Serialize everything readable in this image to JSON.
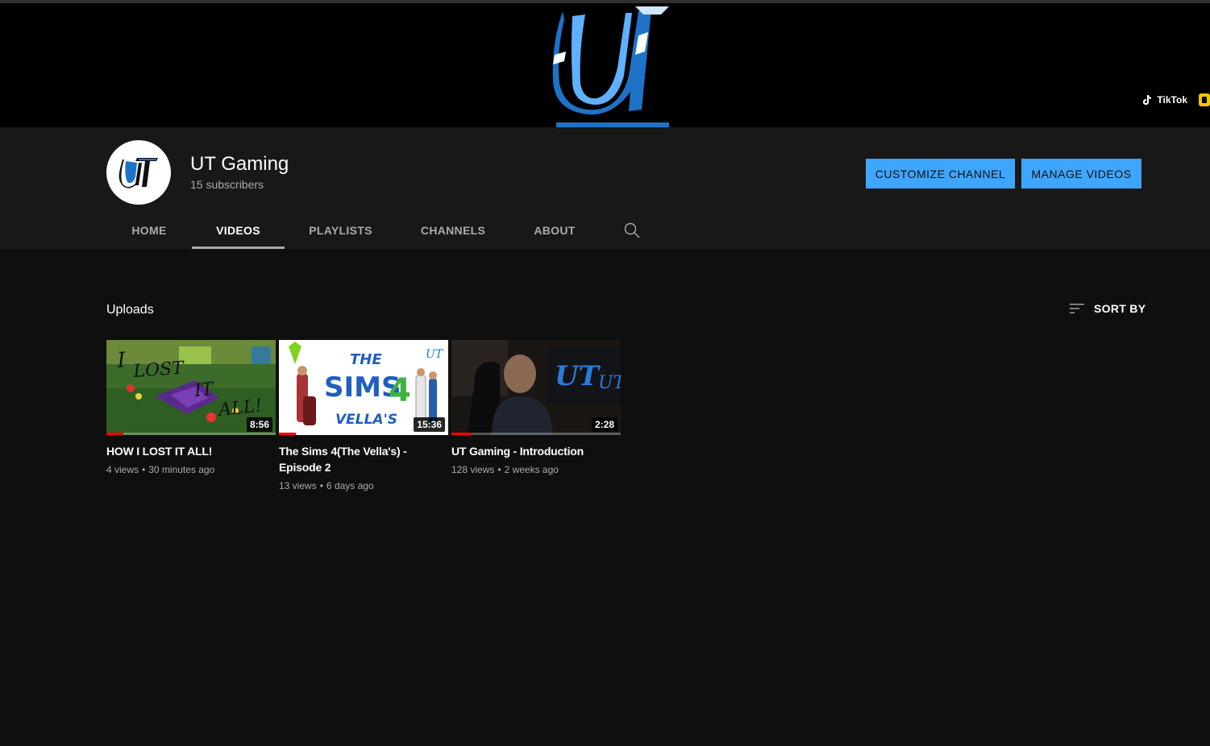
{
  "banner": {
    "links": [
      {
        "label": "TikTok",
        "icon": "tiktok-icon"
      },
      {
        "label": "",
        "icon": "snapchat-icon"
      }
    ]
  },
  "channel": {
    "name": "UT Gaming",
    "subscribers": "15 subscribers",
    "avatar_text": "UT"
  },
  "actions": {
    "customize": "CUSTOMIZE CHANNEL",
    "manage": "MANAGE VIDEOS"
  },
  "tabs": [
    {
      "label": "HOME",
      "active": false
    },
    {
      "label": "VIDEOS",
      "active": true
    },
    {
      "label": "PLAYLISTS",
      "active": false
    },
    {
      "label": "CHANNELS",
      "active": false
    },
    {
      "label": "ABOUT",
      "active": false
    }
  ],
  "section": {
    "title": "Uploads",
    "sort_label": "SORT BY"
  },
  "videos": [
    {
      "title": "HOW I LOST IT ALL!",
      "views": "4 views",
      "age": "30 minutes ago",
      "duration": "8:56",
      "progress": 0.1
    },
    {
      "title": "The Sims 4(The Vella's) - Episode 2",
      "views": "13 views",
      "age": "6 days ago",
      "duration": "15:36",
      "progress": 0.1
    },
    {
      "title": "UT Gaming - Introduction",
      "views": "128 views",
      "age": "2 weeks ago",
      "duration": "2:28",
      "progress": 0.12
    }
  ],
  "colors": {
    "accent": "#3ea6ff",
    "background": "#0f0f0f",
    "header": "#181818",
    "progress": "#ff0000"
  }
}
